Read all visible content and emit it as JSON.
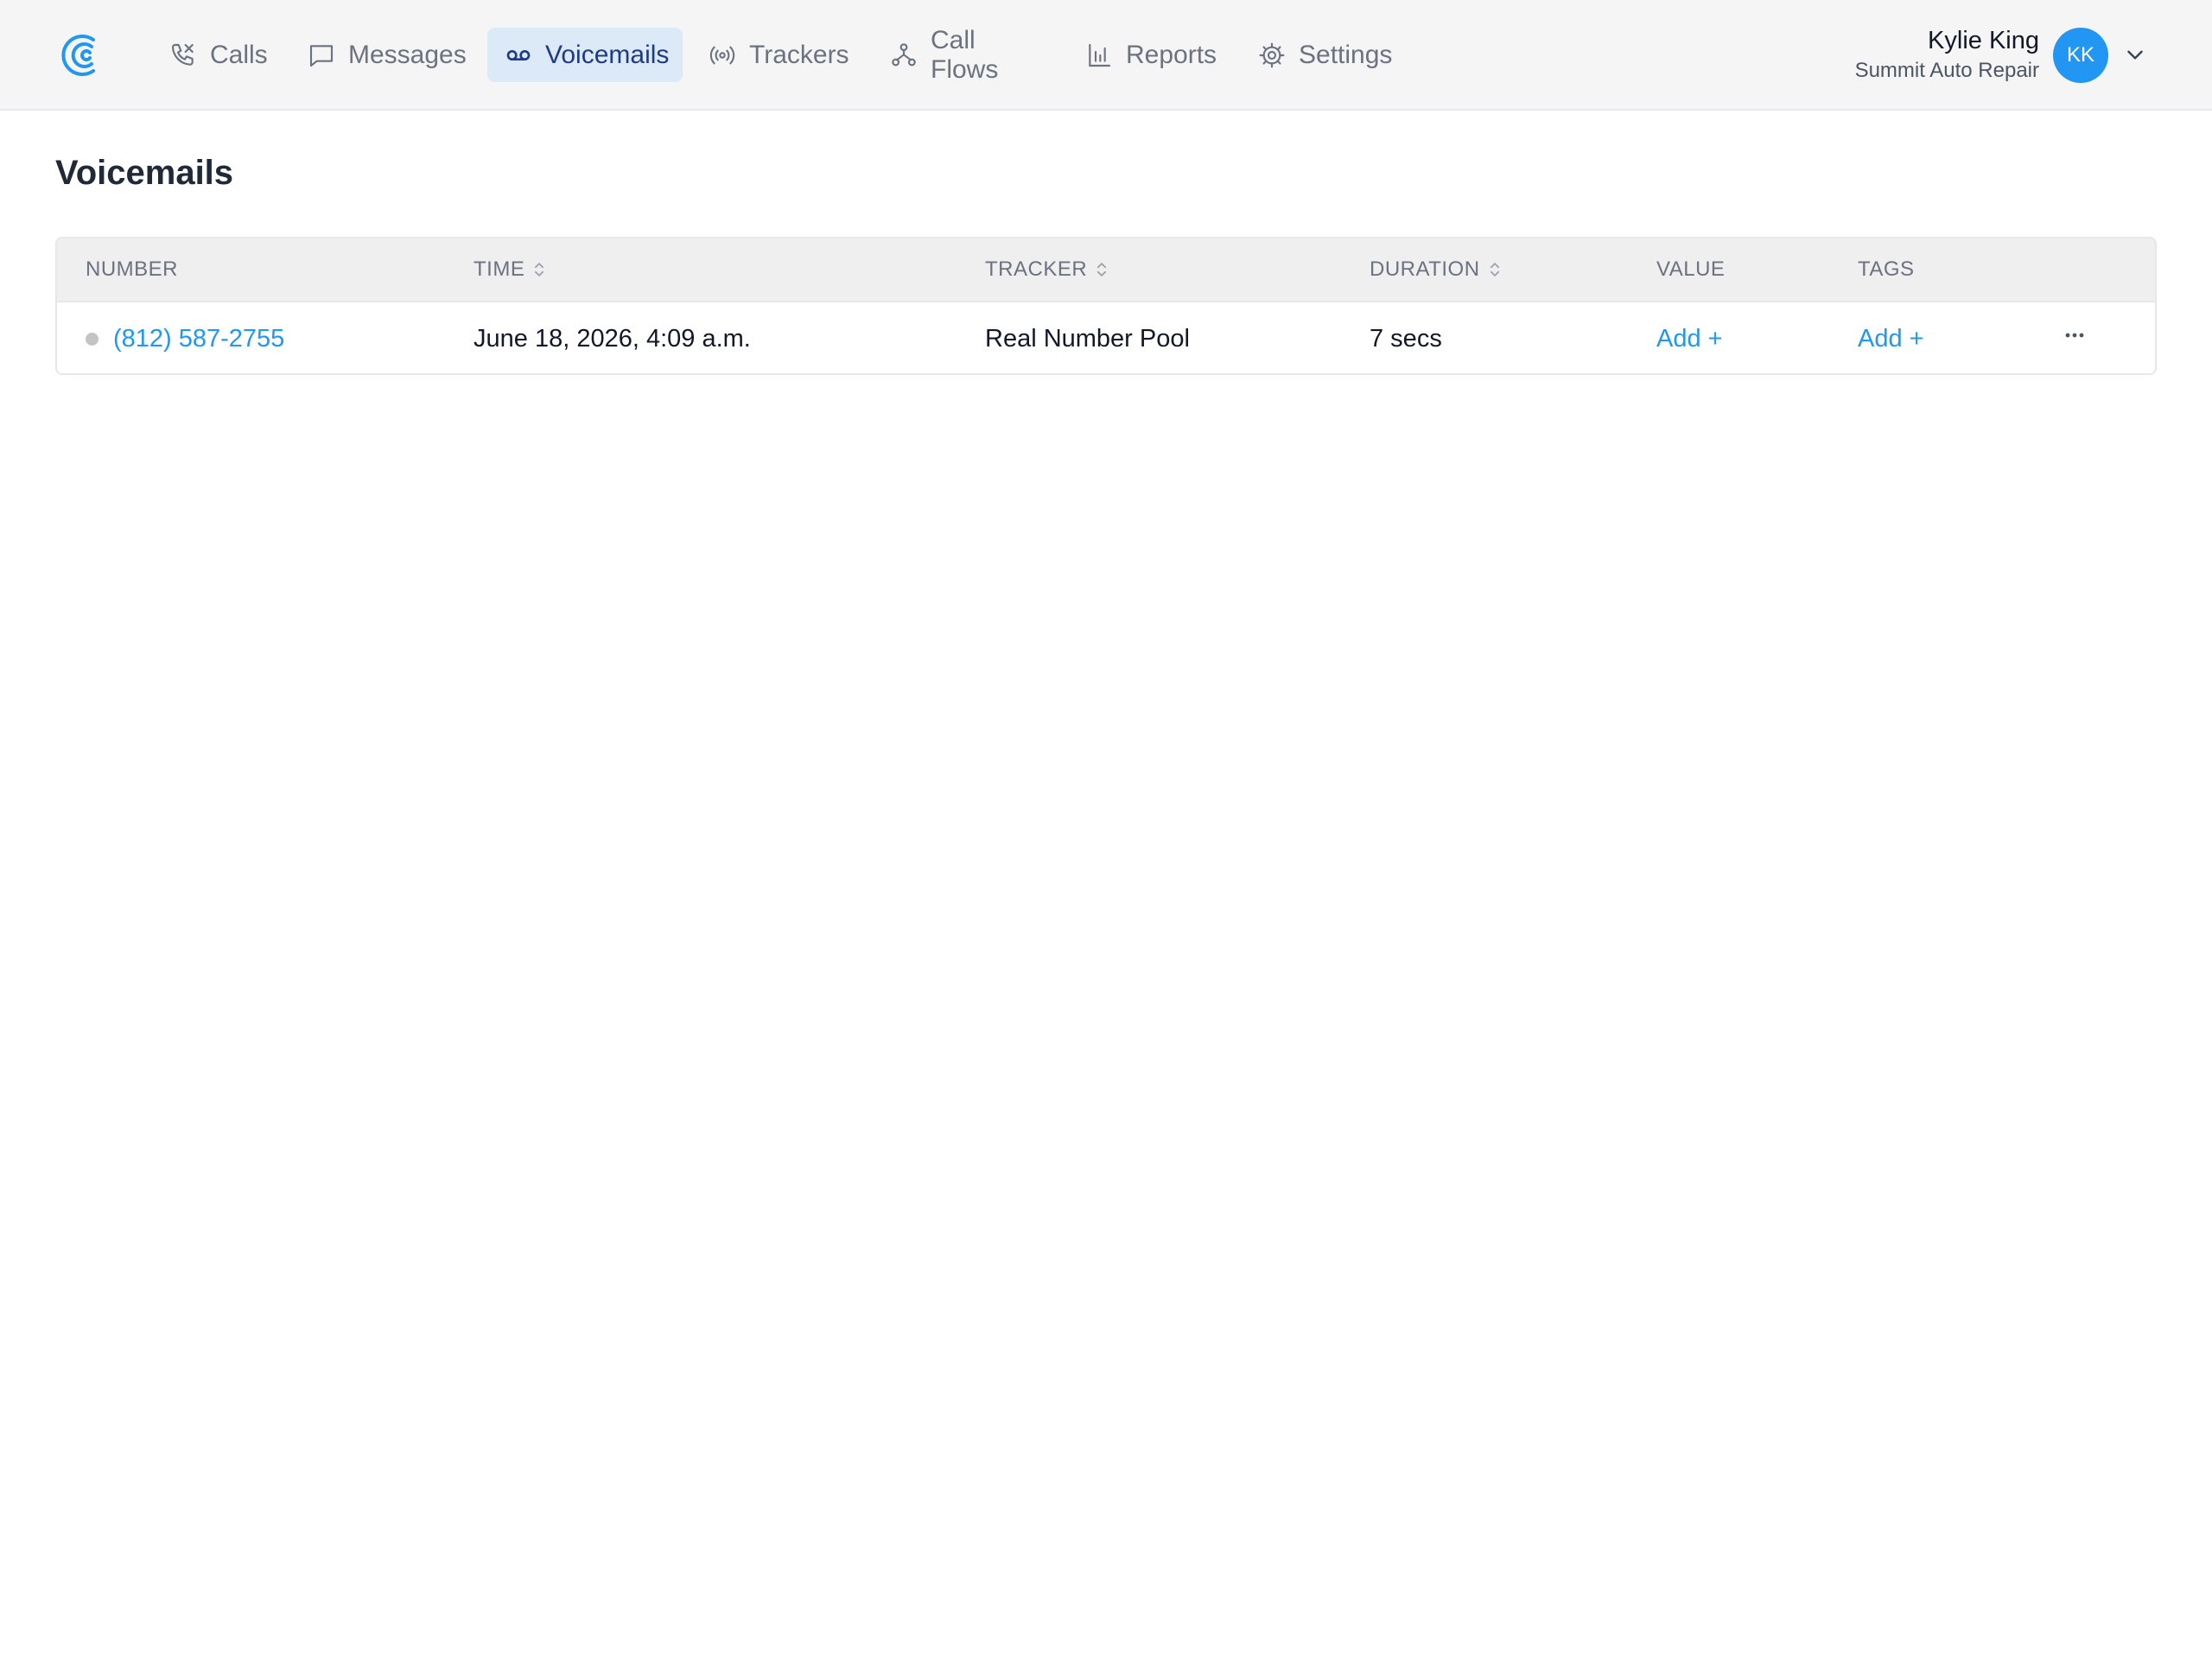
{
  "nav": {
    "items": [
      {
        "label": "Calls",
        "icon": "phone-icon"
      },
      {
        "label": "Messages",
        "icon": "message-icon"
      },
      {
        "label": "Voicemails",
        "icon": "voicemail-icon"
      },
      {
        "label": "Trackers",
        "icon": "broadcast-icon"
      },
      {
        "label": "Call Flows",
        "icon": "flow-icon"
      },
      {
        "label": "Reports",
        "icon": "bar-chart-icon"
      },
      {
        "label": "Settings",
        "icon": "gear-icon"
      }
    ],
    "active": "Voicemails"
  },
  "user": {
    "name": "Kylie King",
    "org": "Summit Auto Repair",
    "initials": "KK"
  },
  "page": {
    "title": "Voicemails"
  },
  "table": {
    "columns": [
      "NUMBER",
      "TIME",
      "TRACKER",
      "DURATION",
      "VALUE",
      "TAGS"
    ],
    "rows": [
      {
        "number": "(812) 587-2755",
        "time": "June 18, 2026, 4:09 a.m.",
        "tracker": "Real Number Pool",
        "duration": "7 secs",
        "value": "Add +",
        "tags": "Add +"
      }
    ]
  },
  "colors": {
    "accent": "#2196f3",
    "active_nav_bg": "#dce9f7",
    "active_nav_text": "#1e3a8a",
    "topbar_bg": "#f5f5f5",
    "header_bg": "#efefef"
  }
}
